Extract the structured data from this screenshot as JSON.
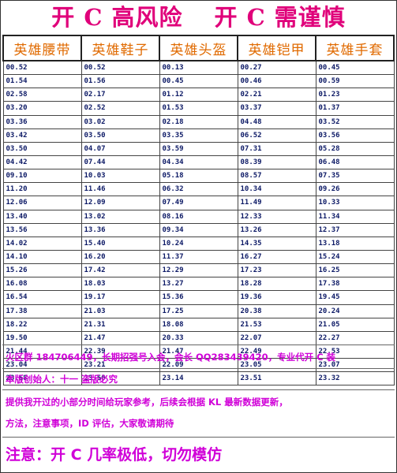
{
  "title": {
    "left": "开 C 高风险",
    "right": "开 C 需谨慎"
  },
  "columns": [
    "英雄腰带",
    "英雄鞋子",
    "英雄头盔",
    "英雄铠甲",
    "英雄手套"
  ],
  "rows": [
    [
      "00.52",
      "00.52",
      "00.13",
      "00.27",
      "00.45"
    ],
    [
      "01.54",
      "01.56",
      "00.45",
      "00.46",
      "00.59"
    ],
    [
      "02.58",
      "02.17",
      "01.12",
      "02.21",
      "01.23"
    ],
    [
      "03.20",
      "02.52",
      "01.53",
      "03.37",
      "01.37"
    ],
    [
      "03.36",
      "03.02",
      "02.18",
      "04.48",
      "03.52"
    ],
    [
      "03.42",
      "03.50",
      "03.35",
      "06.52",
      "03.56"
    ],
    [
      "03.50",
      "04.07",
      "03.59",
      "07.31",
      "05.28"
    ],
    [
      "04.42",
      "07.44",
      "04.34",
      "08.39",
      "06.48"
    ],
    [
      "09.10",
      "10.03",
      "05.18",
      "08.57",
      "07.35"
    ],
    [
      "11.20",
      "11.46",
      "06.32",
      "10.34",
      "09.26"
    ],
    [
      "12.06",
      "12.09",
      "07.49",
      "11.49",
      "10.33"
    ],
    [
      "13.40",
      "13.02",
      "08.16",
      "12.33",
      "11.34"
    ],
    [
      "13.56",
      "13.36",
      "09.34",
      "13.26",
      "12.37"
    ],
    [
      "14.02",
      "15.40",
      "10.24",
      "14.35",
      "13.18"
    ],
    [
      "14.10",
      "16.20",
      "11.37",
      "16.27",
      "15.24"
    ],
    [
      "15.26",
      "17.42",
      "12.29",
      "17.23",
      "16.25"
    ],
    [
      "16.08",
      "18.03",
      "13.27",
      "18.28",
      "17.38"
    ],
    [
      "16.54",
      "19.17",
      "15.36",
      "19.36",
      "19.45"
    ],
    [
      "17.38",
      "21.03",
      "17.25",
      "20.38",
      "20.24"
    ],
    [
      "18.22",
      "21.31",
      "18.08",
      "21.53",
      "21.05"
    ],
    [
      "19.50",
      "21.47",
      "20.33",
      "22.07",
      "22.27"
    ],
    [
      "21.44",
      "22.39",
      "21.47",
      "22.49",
      "22.53"
    ],
    [
      "23.04",
      "23.21",
      "22.09",
      "23.05",
      "23.07"
    ],
    [
      "23.58",
      "23.56",
      "23.14",
      "23.51",
      "23.32"
    ]
  ],
  "notes": {
    "line1": "火区群 184706449，长期招强号入会，会长 QQ283439420，专业代开 C 装",
    "line2": "本版创始人：十一   盗版必究",
    "line3": "提供我开过的小部分时间给玩家参考，后续会根据 KL 最新数据更新，",
    "line4": "方法，注意事项，ID 评估，大家敬请期待"
  },
  "footer": "注意：开 C 几率极低，切勿模仿",
  "colors": {
    "title": "#e0007a",
    "header": "#e06a00",
    "cell_text": "#0d1a66",
    "notes": "#d000d8"
  }
}
